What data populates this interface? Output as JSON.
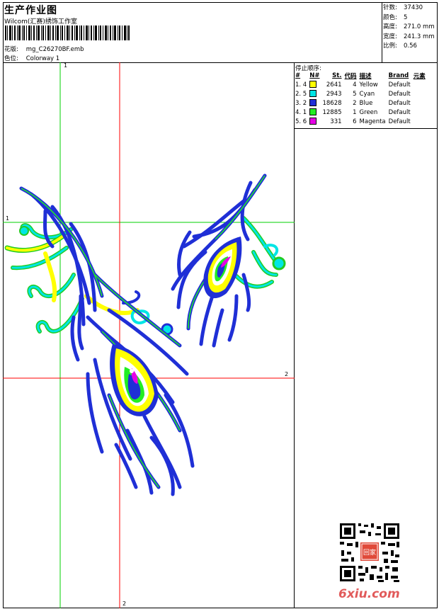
{
  "header": {
    "title": "生产作业图",
    "subtitle": "Wilcom(汇赛)绣饰工作室",
    "design_label": "花版:",
    "design_value": "mg_C26270BF.emb",
    "colorway_label": "色位:",
    "colorway_value": "Colorway 1"
  },
  "stats": [
    {
      "label": "针数:",
      "value": "37430"
    },
    {
      "label": "颜色:",
      "value": "5"
    },
    {
      "label": "高度:",
      "value": "271.0 mm"
    },
    {
      "label": "宽度:",
      "value": "241.3 mm"
    },
    {
      "label": "比例:",
      "value": "0.56"
    }
  ],
  "sequence": {
    "title": "停止顺序:",
    "headers": [
      "#",
      "N#",
      "St.",
      "代码",
      "描述",
      "Brand",
      "元素"
    ],
    "rows": [
      {
        "idx": "1. 4",
        "stitches": "2641",
        "code": "4",
        "desc": "Yellow",
        "brand": "Default",
        "color": "#ffff00"
      },
      {
        "idx": "2. 5",
        "stitches": "2943",
        "code": "5",
        "desc": "Cyan",
        "brand": "Default",
        "color": "#00e5e5"
      },
      {
        "idx": "3. 2",
        "stitches": "18628",
        "code": "2",
        "desc": "Blue",
        "brand": "Default",
        "color": "#1f2fd6"
      },
      {
        "idx": "4. 1",
        "stitches": "12885",
        "code": "1",
        "desc": "Green",
        "brand": "Default",
        "color": "#22ee22"
      },
      {
        "idx": "5. 6",
        "stitches": "331",
        "code": "6",
        "desc": "Magenta",
        "brand": "Default",
        "color": "#e600e6"
      }
    ]
  },
  "guides": {
    "green_v_label": "1",
    "green_h_label": "1",
    "red_h_label": "2",
    "red_v_label": "2"
  },
  "watermark": "6xiu.com",
  "qr_stamp": "回家"
}
